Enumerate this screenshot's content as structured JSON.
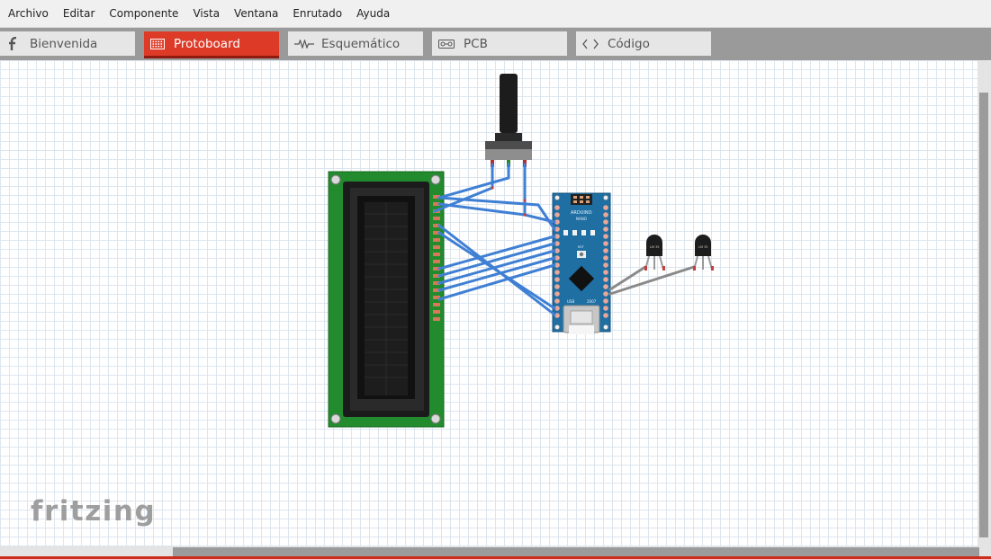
{
  "menu": [
    "Archivo",
    "Editar",
    "Componente",
    "Vista",
    "Ventana",
    "Enrutado",
    "Ayuda"
  ],
  "tabs": [
    {
      "label": "Bienvenida",
      "icon": "fritzing-f-icon",
      "active": false
    },
    {
      "label": "Protoboard",
      "icon": "breadboard-icon",
      "active": true
    },
    {
      "label": "Esquemático",
      "icon": "resistor-icon",
      "active": false
    },
    {
      "label": "PCB",
      "icon": "pcb-icon",
      "active": false
    },
    {
      "label": "Código",
      "icon": "code-icon",
      "active": false
    }
  ],
  "logo": "fritzing",
  "board": {
    "title": "ARDUINO",
    "subtitle": "NANO",
    "rst": "RST",
    "usb": "USB",
    "year": "2007"
  },
  "sensors": [
    "LM 35",
    "LM 35"
  ],
  "colors": {
    "accent": "#dd3b28",
    "wire_blue": "#3f7fd4",
    "wire_gray": "#8a8a8a",
    "lcd_pcb": "#228b2e",
    "arduino": "#1f6fa3"
  }
}
